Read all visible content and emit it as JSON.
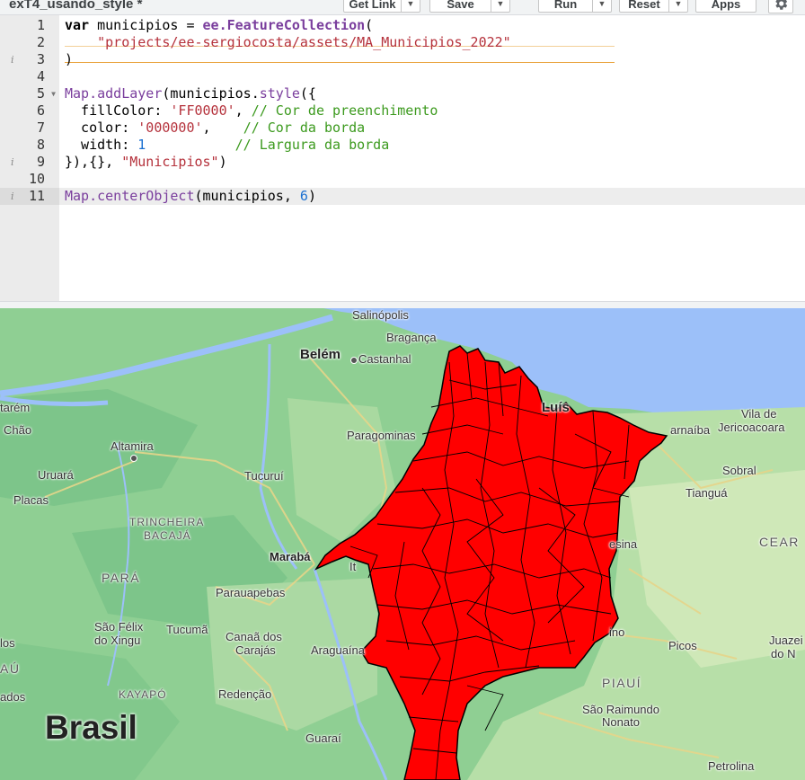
{
  "header": {
    "script_title": "exT4_usando_style *",
    "buttons": {
      "get_link": "Get Link",
      "save": "Save",
      "run": "Run",
      "reset": "Reset",
      "apps": "Apps"
    }
  },
  "editor": {
    "line_numbers": [
      "1",
      "2",
      "3",
      "4",
      "5",
      "6",
      "7",
      "8",
      "9",
      "10",
      "11"
    ],
    "lines": {
      "l1": {
        "kw": "var",
        "p1": " municipios = ",
        "fn": "ee.FeatureCollection",
        "p2": "("
      },
      "l2": {
        "str": "\"projects/ee-sergiocosta/assets/MA_Municipios_2022\""
      },
      "l3": {
        "p": ")"
      },
      "l5": {
        "fn": "Map.addLayer",
        "p1": "(municipios.",
        "fn2": "style",
        "p2": "({"
      },
      "l6": {
        "p1": "  fillColor: ",
        "str": "'FF0000'",
        "p2": ", ",
        "cmt": "// Cor de preenchimento"
      },
      "l7": {
        "p1": "  color: ",
        "str": "'000000'",
        "p2": ",    ",
        "cmt": "// Cor da borda"
      },
      "l8": {
        "p1": "  width: ",
        "num": "1",
        "p2": "           ",
        "cmt": "// Largura da borda"
      },
      "l9": {
        "p1": "}),{}, ",
        "str": "\"Municipios\"",
        "p2": ")"
      },
      "l11": {
        "fn": "Map.centerObject",
        "p1": "(municipios, ",
        "num": "6",
        "p2": ")"
      }
    }
  },
  "map": {
    "labels": {
      "salinopolis": "Salinópolis",
      "braganca": "Bragança",
      "belem": "Belém",
      "castanhal": "Castanhal",
      "santarem": "tarém",
      "obidos": "Chão",
      "altamira": "Altamira",
      "paragominas": "Paragominas",
      "uruara": "Uruará",
      "placas": "Placas",
      "tucurui": "Tucuruí",
      "trincheira": "TRINCHEIRA",
      "bacaja": "BACAJÁ",
      "maraba": "Marabá",
      "para": "PARÁ",
      "parauapebas": "Parauapebas",
      "sao_felix": "São Félix",
      "do_xingu": "do Xingu",
      "tucuma": "Tucumã",
      "canaa": "Canaã dos",
      "carajas": "Carajás",
      "araguaina": "Araguaína",
      "kayapo": "KAYAPÓ",
      "redencao": "Redenção",
      "brasil": "Brasil",
      "guarai": "Guaraí",
      "luis": "Luís",
      "vila_de": "Vila de",
      "jericoacoara": "Jericoacoara",
      "parnaiba": "arnaíba",
      "sobral": "Sobral",
      "tiangua": "Tianguá",
      "ceara": "CEAR",
      "teresina": "esina",
      "picos": "Picos",
      "juazeiro": "Juazei",
      "do_norte": "do N",
      "piaui": "PIAUÍ",
      "sao_raimundo": "São Raimundo",
      "nonato": "Nonato",
      "petrolina": "Petrolina",
      "au": "AÚ",
      "ados": "ados",
      "it": "It",
      "ino": "ino",
      "los": "los"
    },
    "colors": {
      "land": "#8fcf93",
      "sea": "#9cc0f9",
      "layer_fill": "#FF0000",
      "layer_border": "#000000"
    }
  }
}
